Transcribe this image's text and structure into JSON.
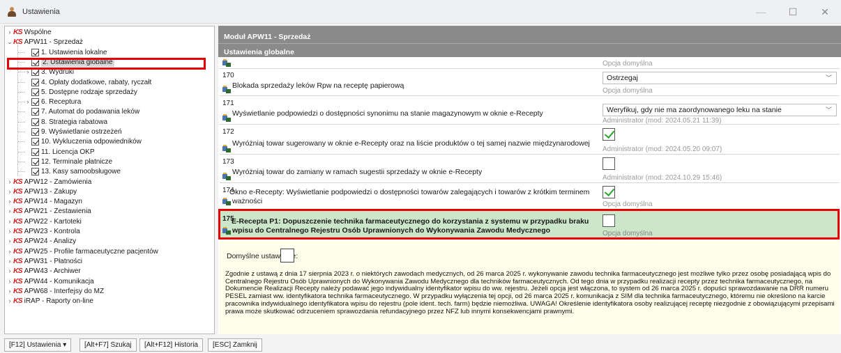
{
  "window": {
    "title": "Ustawienia",
    "minimize": "—",
    "maximize": "☐",
    "close": "✕"
  },
  "tree": {
    "items": [
      {
        "label": "Wspólne",
        "expander": "›",
        "icon": "ks"
      },
      {
        "label": "APW11 - Sprzedaż",
        "expander": "⌄",
        "icon": "ks"
      },
      {
        "label": "1. Ustawienia lokalne",
        "icon": "check"
      },
      {
        "label": "2. Ustawienia globalne",
        "icon": "check",
        "selected": true
      },
      {
        "label": "3. Wydruki",
        "expander": "›",
        "icon": "check"
      },
      {
        "label": "4. Opłaty dodatkowe, rabaty, ryczałt",
        "icon": "check"
      },
      {
        "label": "5. Dostępne rodzaje sprzedaży",
        "icon": "check"
      },
      {
        "label": "6. Receptura",
        "expander": "›",
        "icon": "check"
      },
      {
        "label": "7. Automat do podawania leków",
        "icon": "check"
      },
      {
        "label": "8. Strategia rabatowa",
        "icon": "check"
      },
      {
        "label": "9. Wyświetlanie ostrzeżeń",
        "icon": "check"
      },
      {
        "label": "10. Wykluczenia odpowiedników",
        "icon": "check"
      },
      {
        "label": "11. Licencja OKP",
        "icon": "check"
      },
      {
        "label": "12. Terminale płatnicze",
        "icon": "check"
      },
      {
        "label": "13. Kasy samoobsługowe",
        "icon": "check"
      },
      {
        "label": "APW12 - Zamówienia",
        "expander": "›",
        "icon": "ks"
      },
      {
        "label": "APW13 - Zakupy",
        "expander": "›",
        "icon": "ks"
      },
      {
        "label": "APW14 - Magazyn",
        "expander": "›",
        "icon": "ks"
      },
      {
        "label": "APW21 - Zestawienia",
        "expander": "›",
        "icon": "ks"
      },
      {
        "label": "APW22 - Kartoteki",
        "expander": "›",
        "icon": "ks"
      },
      {
        "label": "APW23 - Kontrola",
        "expander": "›",
        "icon": "ks"
      },
      {
        "label": "APW24 - Analizy",
        "expander": "›",
        "icon": "ks"
      },
      {
        "label": "APW25 - Profile farmaceutyczne pacjentów",
        "expander": "›",
        "icon": "ks"
      },
      {
        "label": "APW31 - Płatności",
        "expander": "›",
        "icon": "ks"
      },
      {
        "label": "APW43 - Archiwer",
        "expander": "›",
        "icon": "ks"
      },
      {
        "label": "APW44 - Komunikacja",
        "expander": "›",
        "icon": "ks"
      },
      {
        "label": "APW68 - Interfejsy do MZ",
        "expander": "›",
        "icon": "ks"
      },
      {
        "label": "iRAP - Raporty on-line",
        "expander": "›",
        "icon": "ks"
      }
    ],
    "ks_logo": "KS"
  },
  "panel": {
    "module_title": "Moduł APW11 - Sprzedaż",
    "section_title": "Ustawienia globalne",
    "rows": [
      {
        "num": "",
        "text": "",
        "sub": "Opcja domyślna"
      },
      {
        "num": "170",
        "text": "Blokada sprzedaży leków Rpw na receptę papierową",
        "dropdown": "Ostrzegaj",
        "sub": "Opcja domyślna"
      },
      {
        "num": "171",
        "text": "Wyświetlanie podpowiedzi o dostępności synonimu na stanie magazynowym w oknie e-Recepty",
        "dropdown": "Weryfikuj, gdy nie ma zaordynowanego leku na stanie",
        "sub": "Administrator   (mod: 2024.05.21 11:39)"
      },
      {
        "num": "172",
        "text": "Wyróżniaj towar sugerowany w oknie e-Recepty oraz na liście produktów o tej samej nazwie międzynarodowej",
        "checked": true,
        "sub": "Administrator   (mod: 2024.05.20 09:07)"
      },
      {
        "num": "173",
        "text": "Wyróżniaj towar do zamiany w ramach sugestii sprzedaży w oknie e-Recepty",
        "checked": false,
        "sub": "Administrator   (mod: 2024.10.29 15:46)"
      },
      {
        "num": "174",
        "text": "Okno e-Recepty: Wyświetlanie podpowiedzi o dostępności towarów zalegających i towarów z krótkim terminem",
        "text2": "ważności",
        "checked": true,
        "sub": "Opcja domyślna"
      },
      {
        "num": "175",
        "text": "E-Recepta P1: Dopuszczenie technika farmaceutycznego do korzystania z systemu w przypadku braku",
        "text2": "wpisu do Centralnego Rejestru Osób Uprawnionych do Wykonywania Zawodu Medycznego",
        "checked": false,
        "sub": "Opcja domyślna"
      }
    ],
    "default_label": "Domyślne ustawienie:",
    "default_checked": false,
    "description": "Zgodnie z ustawą z dnia 17 sierpnia 2023 r. o niektórych zawodach medycznych, od 26 marca 2025 r. wykonywanie zawodu technika farmaceutycznego jest możliwe tylko przez osobę posiadającą wpis do Centralnego Rejestru Osób Uprawnionych do Wykonywania Zawodu Medycznego dla techników farmaceutycznych. Od tego dnia w przypadku realizacji recepty przez technika farmaceutycznego, na Dokumencie Realizacji Recepty należy podawać jego indywidualny identyfikator wpisu do ww. rejestru. Jeżeli opcja jest włączona, to system od 26 marca 2025 r. dopuści sprawozdawanie na DRR numeru PESEL zamiast ww. identyfikatora technika farmaceutycznego. W przypadku wyłączenia tej opcji, od 26 marca 2025 r. komunikacja z SIM dla technika farmaceutycznego, któremu nie określono na karcie pracownika indywidualnego identyfikatora wpisu do rejestru (pole ident. tech. farm) będzie niemożliwa. UWAGA! Określenie identyfikatora osoby realizującej receptę niezgodnie z obowiązującymi przepisami prawa może skutkować odrzuceniem sprawozdania refundacyjnego przez NFZ lub innymi konsekwencjami prawnymi."
  },
  "bottom": {
    "btn_settings": "[F12] Ustawienia ▾",
    "btn_search": "[Alt+F7] Szukaj",
    "btn_history": "[Alt+F12] Historia",
    "btn_close": "[ESC] Zamknij"
  },
  "colors": {
    "header": "#8a8a8a",
    "highlight_row": "#cce6c9",
    "desc_bg": "#fffeea",
    "red_frame": "#e60000",
    "checkmark": "#2aa32a",
    "ks_red": "#d42020"
  }
}
